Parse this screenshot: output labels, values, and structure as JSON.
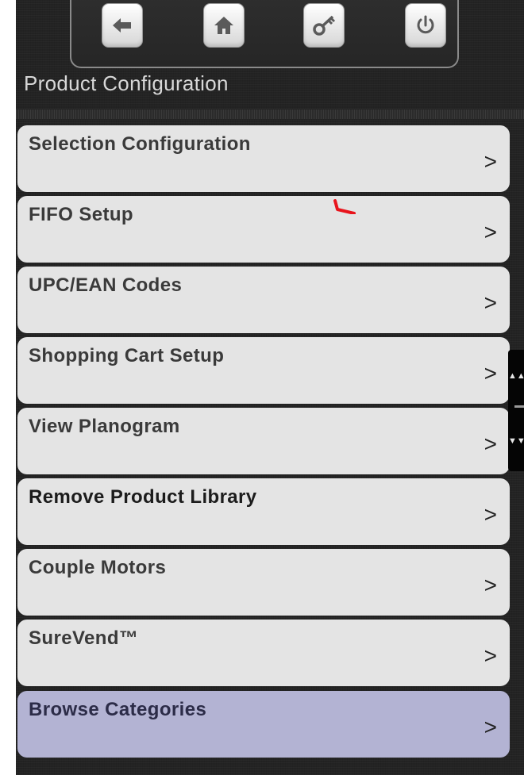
{
  "header": {
    "title": "Product Configuration",
    "buttons": [
      {
        "icon": "back-arrow-icon"
      },
      {
        "icon": "home-icon"
      },
      {
        "icon": "key-icon"
      },
      {
        "icon": "power-icon"
      }
    ]
  },
  "menu": {
    "items": [
      {
        "label": "Selection Configuration",
        "chevron": ">"
      },
      {
        "label": "FIFO Setup",
        "chevron": ">"
      },
      {
        "label": "UPC/EAN Codes",
        "chevron": ">"
      },
      {
        "label": "Shopping Cart Setup",
        "chevron": ">"
      },
      {
        "label": "View Planogram",
        "chevron": ">"
      },
      {
        "label": "Remove Product Library",
        "chevron": ">"
      },
      {
        "label": "Couple Motors",
        "chevron": ">"
      },
      {
        "label": "SureVend™",
        "chevron": ">"
      },
      {
        "label": "Browse Categories",
        "chevron": ">"
      }
    ]
  },
  "scrollbar": {
    "up": "▲▲",
    "down": "▼▼"
  },
  "colors": {
    "background": "#232323",
    "item_background": "#e4e4e4",
    "highlight_background": "#b3b3d3",
    "title_text": "#d8d8d8",
    "annotation_mark": "#e8141c"
  }
}
